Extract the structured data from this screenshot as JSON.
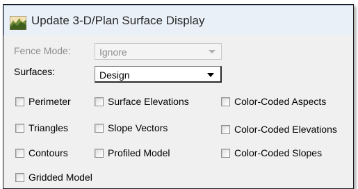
{
  "window": {
    "title": "Update 3-D/Plan Surface Display"
  },
  "fence_mode": {
    "label": "Fence Mode:",
    "value": "Ignore",
    "enabled": false
  },
  "surfaces": {
    "label": "Surfaces:",
    "value": "Design",
    "enabled": true
  },
  "options": {
    "perimeter": {
      "label": "Perimeter",
      "checked": false
    },
    "surface_elevations": {
      "label": "Surface Elevations",
      "checked": false
    },
    "color_coded_aspects": {
      "label": "Color-Coded Aspects",
      "checked": false
    },
    "triangles": {
      "label": "Triangles",
      "checked": false
    },
    "slope_vectors": {
      "label": "Slope Vectors",
      "checked": false
    },
    "color_coded_elevations": {
      "label": "Color-Coded Elevations",
      "checked": false
    },
    "contours": {
      "label": "Contours",
      "checked": false
    },
    "profiled_model": {
      "label": "Profiled Model",
      "checked": false
    },
    "color_coded_slopes": {
      "label": "Color-Coded Slopes",
      "checked": false
    },
    "gridded_model": {
      "label": "Gridded Model",
      "checked": false
    }
  },
  "icons": {
    "app": "terrain-surface-icon",
    "dropdown": "chevron-down-icon"
  }
}
